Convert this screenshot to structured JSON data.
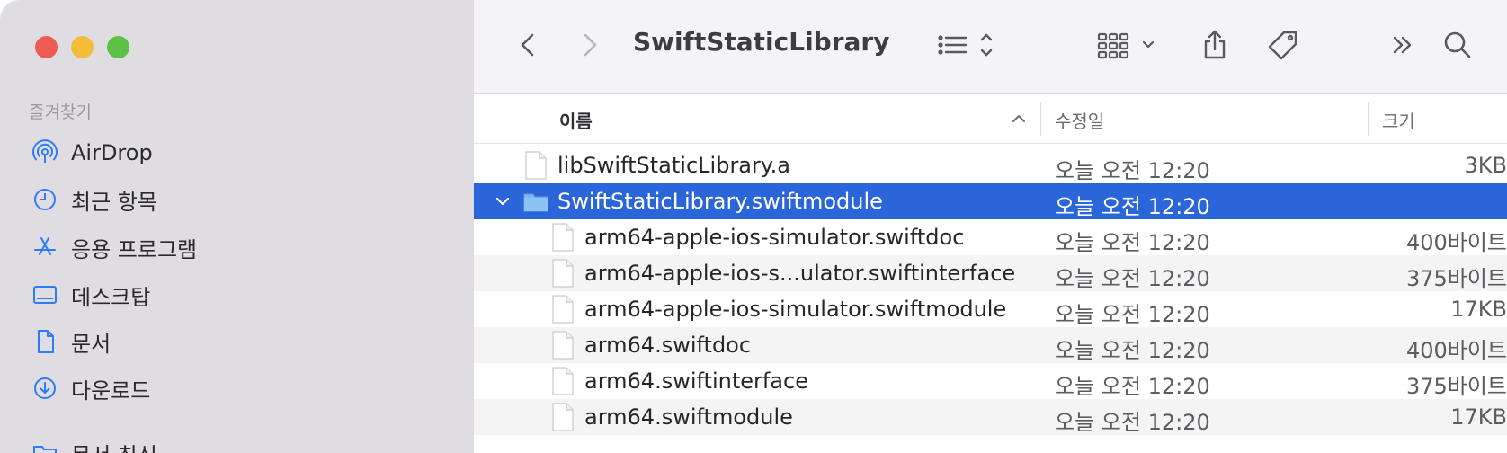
{
  "sidebar": {
    "section_title": "즐겨찾기",
    "items": [
      {
        "label": "AirDrop",
        "icon": "airdrop-icon"
      },
      {
        "label": "최근 항목",
        "icon": "clock-icon"
      },
      {
        "label": "응용 프로그램",
        "icon": "applications-icon"
      },
      {
        "label": "데스크탑",
        "icon": "desktop-icon"
      },
      {
        "label": "문서",
        "icon": "document-icon"
      },
      {
        "label": "다운로드",
        "icon": "download-icon"
      },
      {
        "label": "문서 최신",
        "icon": "folder-icon"
      }
    ]
  },
  "toolbar": {
    "title": "SwiftStaticLibrary"
  },
  "columns": {
    "name": "이름",
    "modified": "수정일",
    "size": "크기"
  },
  "files": [
    {
      "name": "libSwiftStaticLibrary.a",
      "date": "오늘 오전 12:20",
      "size": "3KB",
      "kind": "file",
      "indent": 0
    },
    {
      "name": "SwiftStaticLibrary.swiftmodule",
      "date": "오늘 오전 12:20",
      "size": "",
      "kind": "folder",
      "indent": 0,
      "expanded": true,
      "selected": true
    },
    {
      "name": "arm64-apple-ios-simulator.swiftdoc",
      "date": "오늘 오전 12:20",
      "size": "400바이트",
      "kind": "file",
      "indent": 1
    },
    {
      "name": "arm64-apple-ios-s...ulator.swiftinterface",
      "date": "오늘 오전 12:20",
      "size": "375바이트",
      "kind": "file",
      "indent": 1
    },
    {
      "name": "arm64-apple-ios-simulator.swiftmodule",
      "date": "오늘 오전 12:20",
      "size": "17KB",
      "kind": "file",
      "indent": 1
    },
    {
      "name": "arm64.swiftdoc",
      "date": "오늘 오전 12:20",
      "size": "400바이트",
      "kind": "file",
      "indent": 1
    },
    {
      "name": "arm64.swiftinterface",
      "date": "오늘 오전 12:20",
      "size": "375바이트",
      "kind": "file",
      "indent": 1
    },
    {
      "name": "arm64.swiftmodule",
      "date": "오늘 오전 12:20",
      "size": "17KB",
      "kind": "file",
      "indent": 1
    }
  ],
  "colors": {
    "selection": "#2a65d9",
    "accent": "#2f7cf6"
  }
}
